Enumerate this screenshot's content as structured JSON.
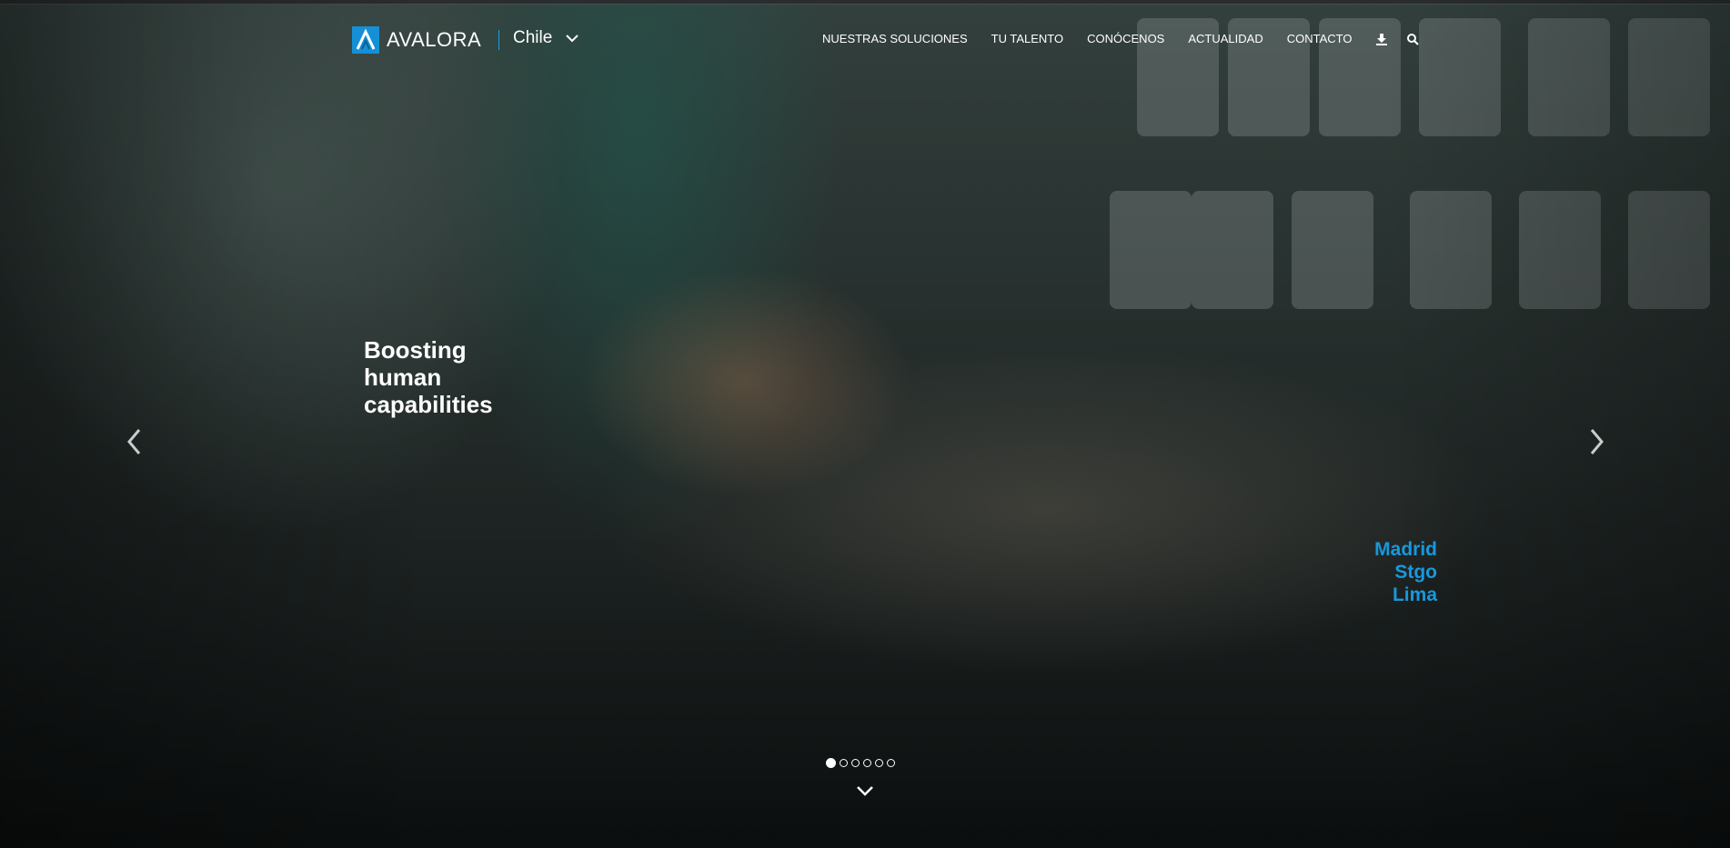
{
  "header": {
    "logo_text": "AVALORA",
    "country": "Chile",
    "nav_items": [
      {
        "label": "NUESTRAS SOLUCIONES"
      },
      {
        "label": "TU TALENTO"
      },
      {
        "label": "CONÓCENOS"
      },
      {
        "label": "ACTUALIDAD"
      },
      {
        "label": "CONTACTO"
      }
    ],
    "icons": [
      "download-icon",
      "search-icon"
    ]
  },
  "hero": {
    "headline_lines": [
      "Boosting",
      "human",
      "capabilities"
    ],
    "cities": [
      "Madrid",
      "Stgo",
      "Lima"
    ],
    "slides_total": 6,
    "active_slide": 1
  },
  "colors": {
    "brand_blue": "#1590d6",
    "city_text": "#1798de",
    "text": "#ffffff"
  }
}
